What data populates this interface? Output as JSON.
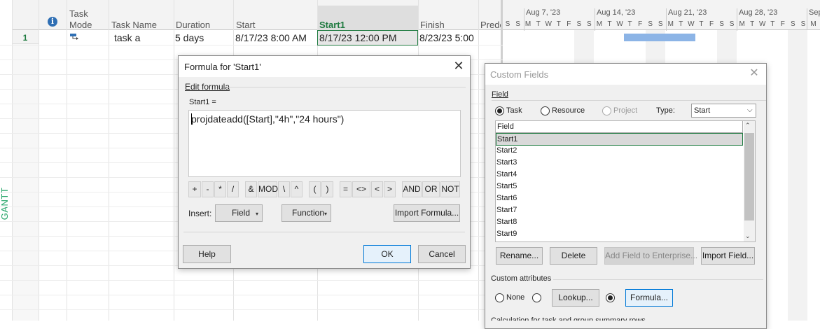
{
  "view": {
    "label": "GANTT CHART"
  },
  "table": {
    "columns": [
      {
        "line1": "Task",
        "line2": "Mode"
      },
      "Task Name",
      "Duration",
      "Start",
      "Start1",
      "Finish",
      "Prede"
    ],
    "rows": [
      {
        "id": "1",
        "name": "task a",
        "duration": "5 days",
        "start": "8/17/23 8:00 AM",
        "start1": "8/17/23 12:00 PM",
        "finish": "8/23/23 5:00"
      }
    ]
  },
  "timescale": {
    "weeks": [
      "Aug 7, '23",
      "Aug 14, '23",
      "Aug 21, '23",
      "Aug 28, '23",
      "Sep"
    ],
    "days": [
      "S",
      "S",
      "M",
      "T",
      "W",
      "T",
      "F",
      "S",
      "S",
      "M",
      "T",
      "W",
      "T",
      "F",
      "S",
      "S",
      "M",
      "T",
      "W",
      "T",
      "F",
      "S",
      "S",
      "M",
      "T",
      "W",
      "T",
      "F",
      "S",
      "S",
      "M"
    ]
  },
  "formula_dialog": {
    "title": "Formula for 'Start1'",
    "edit_label": "Edit formula",
    "field_label": "Start1 =",
    "formula": "projdateadd([Start],\"4h\",\"24 hours\")",
    "operators": [
      "+",
      "-",
      "*",
      "/",
      "&",
      "MOD",
      "\\",
      "^",
      "(",
      ")",
      "=",
      "<>",
      "<",
      ">",
      "AND",
      "OR",
      "NOT"
    ],
    "insert_label": "Insert:",
    "field_button": "Field",
    "function_button": "Function",
    "import_button": "Import Formula...",
    "help_button": "Help",
    "ok_button": "OK",
    "cancel_button": "Cancel"
  },
  "custom_fields": {
    "title": "Custom Fields",
    "field_label": "Field",
    "radio_task": "Task",
    "radio_resource": "Resource",
    "radio_project": "Project",
    "type_label": "Type:",
    "type_value": "Start",
    "list_header": "Field",
    "fields": [
      "Start1",
      "Start2",
      "Start3",
      "Start4",
      "Start5",
      "Start6",
      "Start7",
      "Start8",
      "Start9"
    ],
    "rename_button": "Rename...",
    "delete_button": "Delete",
    "add_enterprise_button": "Add Field to Enterprise...",
    "import_field_button": "Import Field...",
    "custom_attributes_label": "Custom attributes",
    "attr_none": "None",
    "lookup_button": "Lookup...",
    "formula_button": "Formula...",
    "calculation_label": "Calculation for task and group summary rows"
  }
}
